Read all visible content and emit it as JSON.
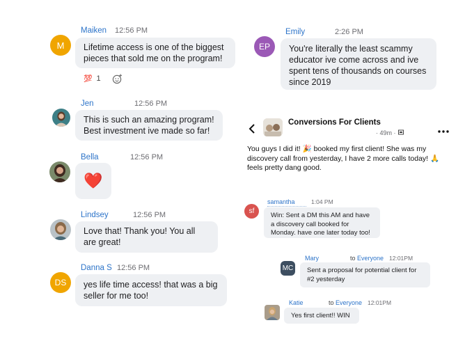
{
  "left_chat": [
    {
      "initials": "M",
      "avatar_color": "#f0a500",
      "name": "Maiken",
      "time": "12:56 PM",
      "message": "Lifetime access is one of the biggest pieces that sold me on the program!"
    },
    {
      "name": "Jen",
      "time": "12:56 PM",
      "message": "This is such an amazing program! Best investment ive made so far!"
    },
    {
      "name": "Bella",
      "time": "12:56 PM",
      "message": "❤️"
    },
    {
      "name": "Lindsey",
      "time": "12:56 PM",
      "message": "Love that! Thank you! You all are great!"
    },
    {
      "initials": "DS",
      "avatar_color": "#f0a500",
      "name": "Danna S",
      "time": "12:56 PM",
      "message": "yes life time access! that was a big seller for me too!"
    }
  ],
  "reaction": {
    "emoji": "💯",
    "count": "1"
  },
  "emily": {
    "initials": "EP",
    "avatar_color": "#9b59b6",
    "name": "Emily",
    "time": "2:26 PM",
    "message": "You're literally the least scammy educator ive come across and ive spent tens of thousands on courses since 2019"
  },
  "fb_post": {
    "group": "Conversions For Clients",
    "meta": "· 49m ·",
    "body": "You guys I did it! 🎉 booked my first client! She was  my discovery call from yesterday, I have 2 more calls today! 🙏 feels pretty dang good."
  },
  "zoom_chat": [
    {
      "initials": "sf",
      "avatar_color": "#d9534f",
      "name": "samantha",
      "time": "1:04 PM",
      "message": "Win: Sent a DM this AM and have a discovery call booked for Monday. have one later today too!"
    },
    {
      "initials": "MC",
      "avatar_color": "#3d4e60",
      "name": "Mary",
      "to_label": "to",
      "to": "Everyone",
      "time": "12:01PM",
      "message": "Sent a proposal for potential client for #2 yesterday"
    },
    {
      "name": "Katie",
      "to_label": "to",
      "to": "Everyone",
      "time": "12:01PM",
      "message": "Yes first client!! WIN"
    }
  ]
}
